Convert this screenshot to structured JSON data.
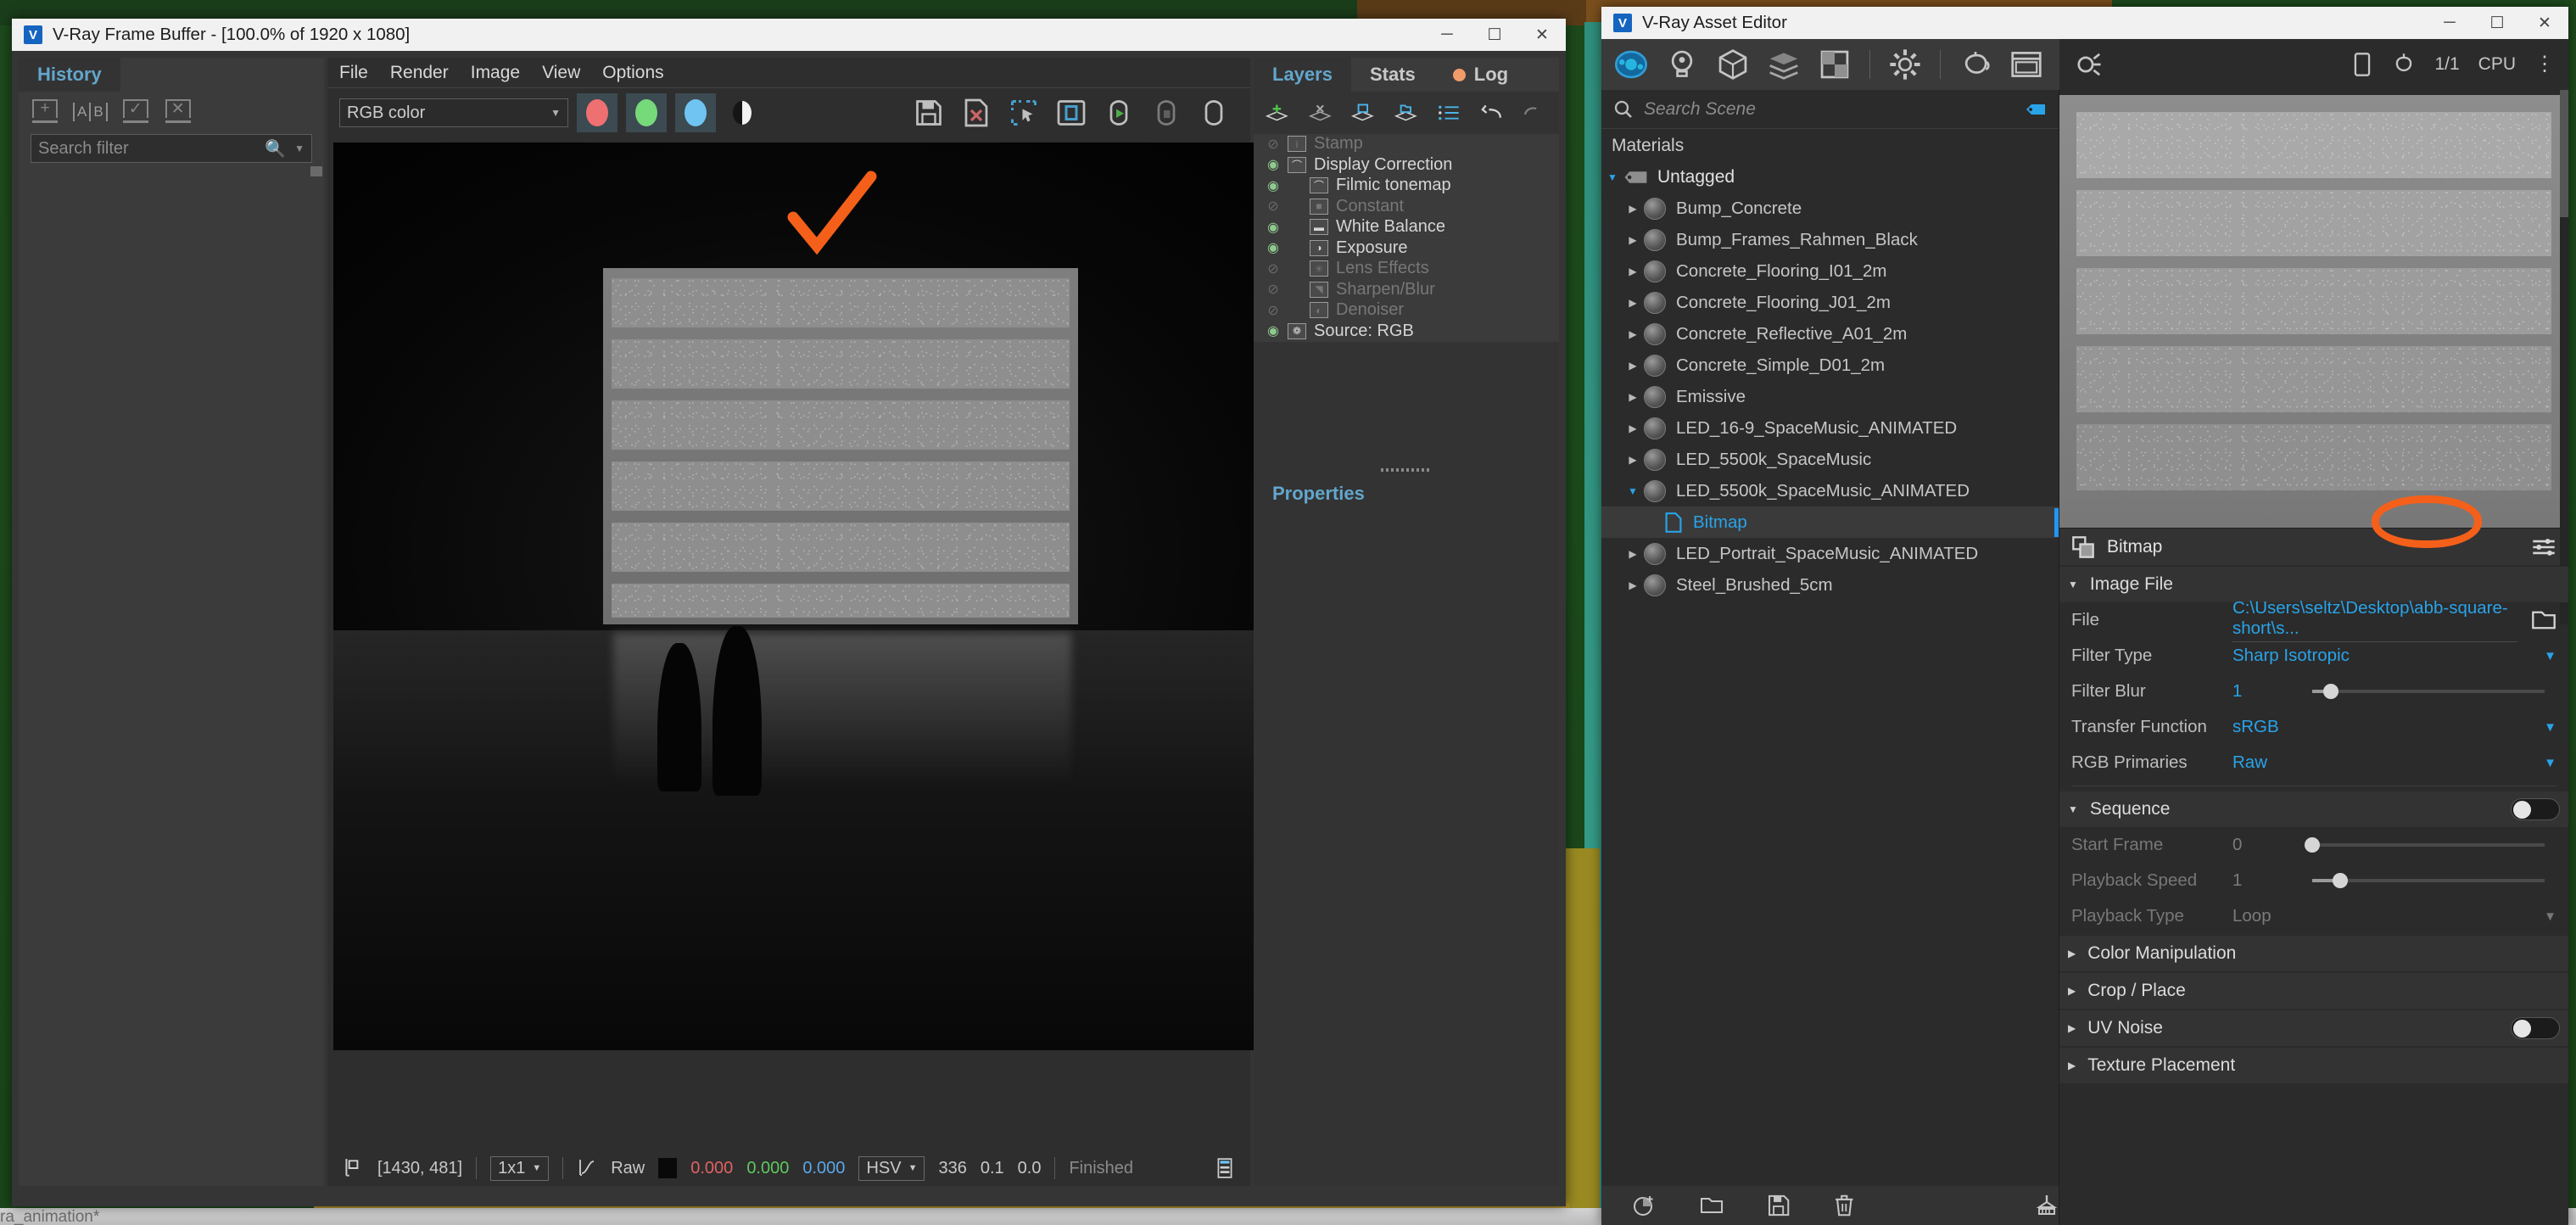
{
  "desktop": {
    "taskbar_text": "ra_animation*"
  },
  "vfb": {
    "title": "V-Ray Frame Buffer - [100.0% of 1920 x 1080]",
    "window_buttons": {
      "minimize": "─",
      "maximize": "☐",
      "close": "✕"
    },
    "history": {
      "tab_label": "History",
      "tools": [
        {
          "name": "add-history-item",
          "glyph": "+"
        },
        {
          "name": "ab-compare",
          "glyph": "A|B"
        },
        {
          "name": "select-history-item",
          "glyph": "✓"
        },
        {
          "name": "delete-history-item",
          "glyph": "✕"
        }
      ],
      "search_placeholder": "Search filter"
    },
    "menu": [
      "File",
      "Render",
      "Image",
      "View",
      "Options"
    ],
    "toolbar": {
      "channel_select": "RGB color",
      "channels": [
        {
          "name": "red-channel-toggle",
          "color": "#ef7070"
        },
        {
          "name": "green-channel-toggle",
          "color": "#76d97a"
        },
        {
          "name": "blue-channel-toggle",
          "color": "#6fc4f2"
        }
      ],
      "alpha_label": "alpha-channel-toggle",
      "right_icons": [
        "save-image-icon",
        "save-as-x-icon",
        "region-render-icon",
        "show-in-window-icon",
        "render-start-icon",
        "render-stop-icon",
        "render-last-icon"
      ]
    },
    "status": {
      "coords": "[1430, 481]",
      "zoom": "1x1",
      "mode": "Raw",
      "r": "0.000",
      "g": "0.000",
      "b": "0.000",
      "color_space": "HSV",
      "h": "336",
      "s": "0.1",
      "v": "0.0",
      "state": "Finished"
    }
  },
  "layers_panel": {
    "tabs": [
      {
        "label": "Layers",
        "active": true
      },
      {
        "label": "Stats",
        "active": false
      },
      {
        "label": "Log",
        "active": false,
        "dot": "#f29b6a"
      }
    ],
    "tools": [
      "add-layer-icon",
      "remove-layer-icon",
      "save-layers-icon",
      "load-layers-icon",
      "layer-presets-icon",
      "undo-icon",
      "redo-icon"
    ],
    "layers": [
      {
        "label": "Stamp",
        "visible": false,
        "indent": 0,
        "thumb": "i"
      },
      {
        "label": "Display Correction",
        "visible": true,
        "indent": 0,
        "thumb": "⌒"
      },
      {
        "label": "Filmic tonemap",
        "visible": true,
        "indent": 1,
        "thumb": "⌒"
      },
      {
        "label": "Constant",
        "visible": false,
        "indent": 1,
        "thumb": "■"
      },
      {
        "label": "White Balance",
        "visible": true,
        "indent": 1,
        "thumb": "▬"
      },
      {
        "label": "Exposure",
        "visible": true,
        "indent": 1,
        "thumb": "◑"
      },
      {
        "label": "Lens Effects",
        "visible": false,
        "indent": 1,
        "thumb": "✳"
      },
      {
        "label": "Sharpen/Blur",
        "visible": false,
        "indent": 1,
        "thumb": "◥"
      },
      {
        "label": "Denoiser",
        "visible": false,
        "indent": 1,
        "thumb": "◐"
      },
      {
        "label": "Source: RGB",
        "visible": true,
        "indent": 0,
        "thumb": "❁"
      }
    ],
    "properties_tab": "Properties"
  },
  "asset_editor": {
    "title": "V-Ray Asset Editor",
    "window_buttons": {
      "minimize": "─",
      "maximize": "☐",
      "close": "✕"
    },
    "toolbar_icons": [
      "materials-icon",
      "lights-icon",
      "geometry-icon",
      "render-elements-icon",
      "textures-icon",
      "settings-icon",
      "teapot-preview-icon",
      "viewport-icon"
    ],
    "status_right": {
      "frame": "1/1",
      "device": "CPU"
    },
    "search": {
      "placeholder": "Search Scene",
      "tag_icon": "tag-filter-icon"
    },
    "materials_header": "Materials",
    "tree": [
      {
        "label": "Untagged",
        "type": "tag",
        "expanded": true,
        "indent": 0
      },
      {
        "label": "Bump_Concrete",
        "type": "material",
        "expanded": false,
        "indent": 1
      },
      {
        "label": "Bump_Frames_Rahmen_Black",
        "type": "material",
        "expanded": false,
        "indent": 1
      },
      {
        "label": "Concrete_Flooring_I01_2m",
        "type": "material",
        "expanded": false,
        "indent": 1
      },
      {
        "label": "Concrete_Flooring_J01_2m",
        "type": "material",
        "expanded": false,
        "indent": 1
      },
      {
        "label": "Concrete_Reflective_A01_2m",
        "type": "material",
        "expanded": false,
        "indent": 1
      },
      {
        "label": "Concrete_Simple_D01_2m",
        "type": "material",
        "expanded": false,
        "indent": 1
      },
      {
        "label": "Emissive",
        "type": "material",
        "expanded": false,
        "indent": 1
      },
      {
        "label": "LED_16-9_SpaceMusic_ANIMATED",
        "type": "material",
        "expanded": false,
        "indent": 1
      },
      {
        "label": "LED_5500k_SpaceMusic",
        "type": "material",
        "expanded": false,
        "indent": 1
      },
      {
        "label": "LED_5500k_SpaceMusic_ANIMATED",
        "type": "material",
        "expanded": true,
        "indent": 1
      },
      {
        "label": "Bitmap",
        "type": "bitmap",
        "selected": true,
        "indent": 2
      },
      {
        "label": "LED_Portrait_SpaceMusic_ANIMATED",
        "type": "material",
        "expanded": false,
        "indent": 1
      },
      {
        "label": "Steel_Brushed_5cm",
        "type": "material",
        "expanded": false,
        "indent": 1
      }
    ],
    "bitmap": {
      "header": "Bitmap",
      "header_icon": "bitmap-icon",
      "options_icon": "parameter-options-icon",
      "sections": {
        "image_file": {
          "title": "Image File",
          "expanded": true,
          "rows": [
            {
              "label": "File",
              "value": "C:\\Users\\seltz\\Desktop\\abb-square-short\\s...",
              "control": "file"
            },
            {
              "label": "Filter Type",
              "value": "Sharp Isotropic",
              "control": "dropdown"
            },
            {
              "label": "Filter Blur",
              "value": "1",
              "control": "slider",
              "pos": 8
            },
            {
              "label": "Transfer Function",
              "value": "sRGB",
              "control": "dropdown"
            },
            {
              "label": "RGB Primaries",
              "value": "Raw",
              "control": "dropdown"
            }
          ]
        },
        "sequence": {
          "title": "Sequence",
          "expanded": true,
          "toggle_on": false,
          "annotated": true,
          "rows": [
            {
              "label": "Start Frame",
              "value": "0",
              "control": "slider",
              "pos": 0,
              "disabled": true
            },
            {
              "label": "Playback Speed",
              "value": "1",
              "control": "slider",
              "pos": 12,
              "disabled": true
            },
            {
              "label": "Playback Type",
              "value": "Loop",
              "control": "dropdown",
              "disabled": true
            }
          ]
        },
        "collapsed": [
          {
            "title": "Color Manipulation",
            "toggle": false
          },
          {
            "title": "Crop / Place",
            "toggle": false
          },
          {
            "title": "UV Noise",
            "toggle": true
          },
          {
            "title": "Texture Placement",
            "toggle": false
          }
        ]
      }
    },
    "bottom_icons": [
      "add-asset-icon",
      "open-scene-icon",
      "save-scene-icon",
      "delete-asset-icon",
      "purge-icon"
    ]
  }
}
